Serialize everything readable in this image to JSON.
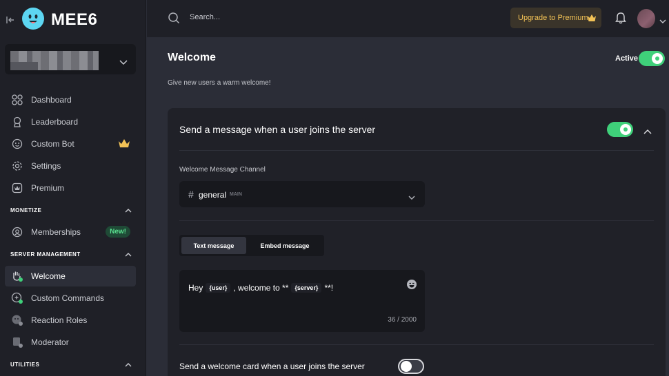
{
  "brand": {
    "name": "MEE6",
    "logo_color": "#5dd6f2"
  },
  "sidebar": {
    "items": [
      {
        "label": "Dashboard",
        "icon": "grid-icon"
      },
      {
        "label": "Leaderboard",
        "icon": "medal-icon"
      },
      {
        "label": "Custom Bot",
        "icon": "smiley-icon"
      },
      {
        "label": "Settings",
        "icon": "gear-icon"
      },
      {
        "label": "Premium",
        "icon": "premium-icon"
      }
    ],
    "monetize_header": "MONETIZE",
    "monetize_items": [
      {
        "label": "Memberships",
        "icon": "membership-icon",
        "badge": "New!"
      }
    ],
    "server_mgmt_header": "SERVER MANAGEMENT",
    "server_mgmt_items": [
      {
        "label": "Welcome",
        "icon": "wave-hand-icon",
        "active": true
      },
      {
        "label": "Custom Commands",
        "icon": "command-icon"
      },
      {
        "label": "Reaction Roles",
        "icon": "reaction-icon"
      },
      {
        "label": "Moderator",
        "icon": "hammer-icon"
      }
    ],
    "utilities_header": "UTILITIES"
  },
  "topbar": {
    "search_placeholder": "Search...",
    "upgrade_label": "Upgrade to Premium"
  },
  "main": {
    "title": "Welcome",
    "subtitle": "Give new users a warm welcome!",
    "active_label": "Active",
    "active_on": true,
    "card": {
      "title": "Send a message when a user joins the server",
      "enabled": true,
      "channel_label": "Welcome Message Channel",
      "channel_hash": "#",
      "channel_name": "general",
      "channel_tag": "MAIN",
      "tabs": [
        "Text message",
        "Embed message"
      ],
      "message": {
        "part1": "Hey",
        "tag_user": "{user}",
        "part2": ", welcome to **",
        "tag_server": "{server}",
        "part3": "**!"
      },
      "char_count": "36 / 2000",
      "welcome_card_label": "Send a welcome card when a user joins the server",
      "welcome_card_enabled": false
    }
  },
  "colors": {
    "accent_green": "#3fd07a",
    "premium_gold": "#f2c256",
    "sidebar_bg": "#1f2027",
    "main_bg": "#2b2d37"
  }
}
